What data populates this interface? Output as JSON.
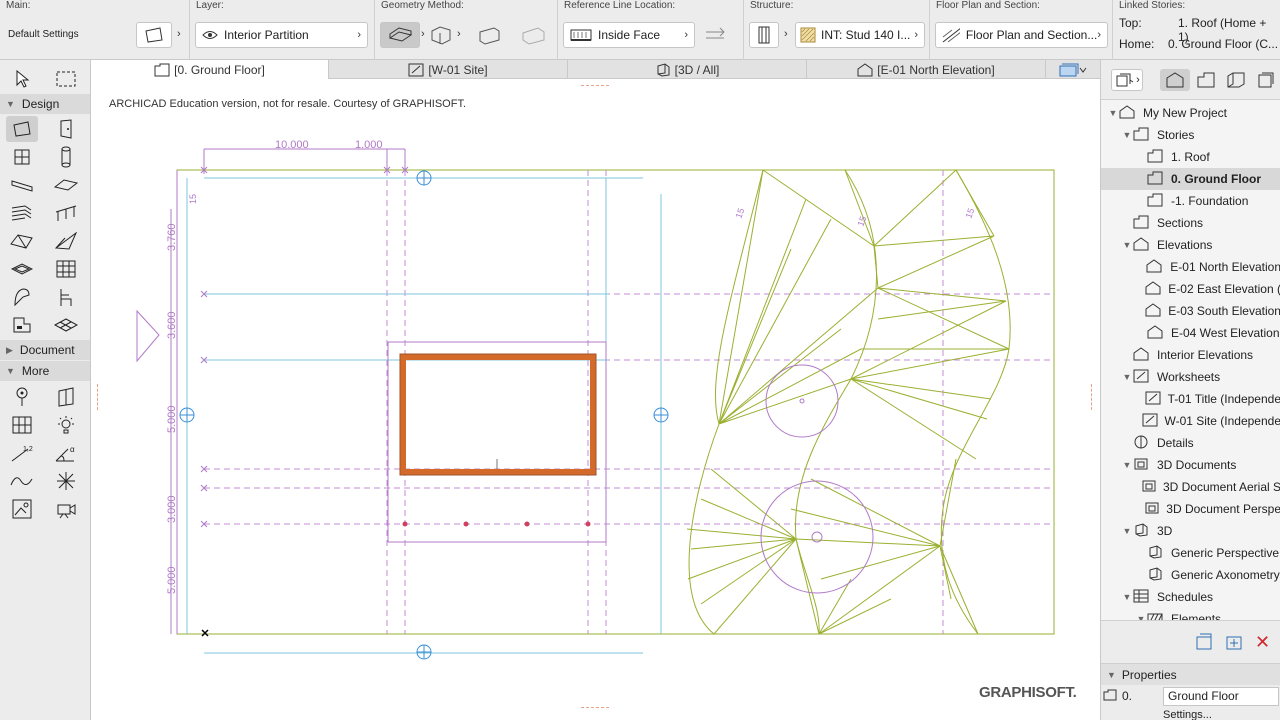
{
  "infobox": {
    "main_label": "Main:",
    "main_value": "Default Settings",
    "layer_label": "Layer:",
    "layer_value": "Interior Partition",
    "geometry_label": "Geometry Method:",
    "refline_label": "Reference Line Location:",
    "refline_value": "Inside Face",
    "structure_label": "Structure:",
    "structure_value": "INT: Stud 140 I...",
    "floorplan_label": "Floor Plan and Section:",
    "floorplan_value": "Floor Plan and Section...",
    "linked_label": "Linked Stories:",
    "top_label": "Top:",
    "top_value": "1. Roof (Home + 1)",
    "home_label": "Home:",
    "home_value": "0. Ground Floor (C..."
  },
  "toolbox": {
    "design_label": "Design",
    "document_label": "Document",
    "more_label": "More"
  },
  "tabs": [
    {
      "label": "[0. Ground Floor]",
      "icon": "floor-plan-icon"
    },
    {
      "label": "[W-01 Site]",
      "icon": "worksheet-icon"
    },
    {
      "label": "[3D / All]",
      "icon": "3d-window-icon"
    },
    {
      "label": "[E-01 North Elevation]",
      "icon": "elevation-icon"
    }
  ],
  "canvas": {
    "edu_notice": "ARCHICAD Education version, not for resale. Courtesy of GRAPHISOFT.",
    "dims_top": [
      "10.000",
      "1.000"
    ],
    "dims_left": [
      "3.760",
      "3.600",
      "5.000",
      "3.000",
      "5.000"
    ],
    "logo_text": "GRAPHISOFT."
  },
  "navigator": {
    "items": [
      {
        "label": "My New Project",
        "level": 0,
        "expanded": true,
        "icon": "project-icon"
      },
      {
        "label": "Stories",
        "level": 1,
        "expanded": true,
        "icon": "stories-icon"
      },
      {
        "label": "1. Roof",
        "level": 2,
        "icon": "story-icon"
      },
      {
        "label": "0. Ground Floor",
        "level": 2,
        "icon": "story-icon",
        "selected": true
      },
      {
        "label": "-1. Foundation",
        "level": 2,
        "icon": "story-icon"
      },
      {
        "label": "Sections",
        "level": 1,
        "icon": "sections-icon"
      },
      {
        "label": "Elevations",
        "level": 1,
        "expanded": true,
        "icon": "elevations-icon"
      },
      {
        "label": "E-01 North Elevation",
        "level": 2,
        "icon": "elevation-icon"
      },
      {
        "label": "E-02 East Elevation (",
        "level": 2,
        "icon": "elevation-icon"
      },
      {
        "label": "E-03 South Elevation",
        "level": 2,
        "icon": "elevation-icon"
      },
      {
        "label": "E-04 West Elevation",
        "level": 2,
        "icon": "elevation-icon"
      },
      {
        "label": "Interior Elevations",
        "level": 1,
        "icon": "interior-elevations-icon"
      },
      {
        "label": "Worksheets",
        "level": 1,
        "expanded": true,
        "icon": "worksheets-icon"
      },
      {
        "label": "T-01 Title (Independe",
        "level": 2,
        "icon": "worksheet-icon"
      },
      {
        "label": "W-01 Site (Independe",
        "level": 2,
        "icon": "worksheet-icon"
      },
      {
        "label": "Details",
        "level": 1,
        "icon": "details-icon"
      },
      {
        "label": "3D Documents",
        "level": 1,
        "expanded": true,
        "icon": "3d-documents-icon"
      },
      {
        "label": "3D Document Aerial S",
        "level": 2,
        "icon": "3d-document-icon"
      },
      {
        "label": "3D Document Perspe",
        "level": 2,
        "icon": "3d-document-icon"
      },
      {
        "label": "3D",
        "level": 1,
        "expanded": true,
        "icon": "3d-icon"
      },
      {
        "label": "Generic Perspective",
        "level": 2,
        "icon": "perspective-icon"
      },
      {
        "label": "Generic Axonometry",
        "level": 2,
        "icon": "axonometry-icon"
      },
      {
        "label": "Schedules",
        "level": 1,
        "expanded": true,
        "icon": "schedules-icon"
      },
      {
        "label": "Elements",
        "level": 2,
        "expanded": true,
        "icon": "elements-icon"
      }
    ],
    "properties_label": "Properties",
    "prop_id": "0.",
    "prop_value": "Ground Floor",
    "settings_label": "Settings..."
  }
}
